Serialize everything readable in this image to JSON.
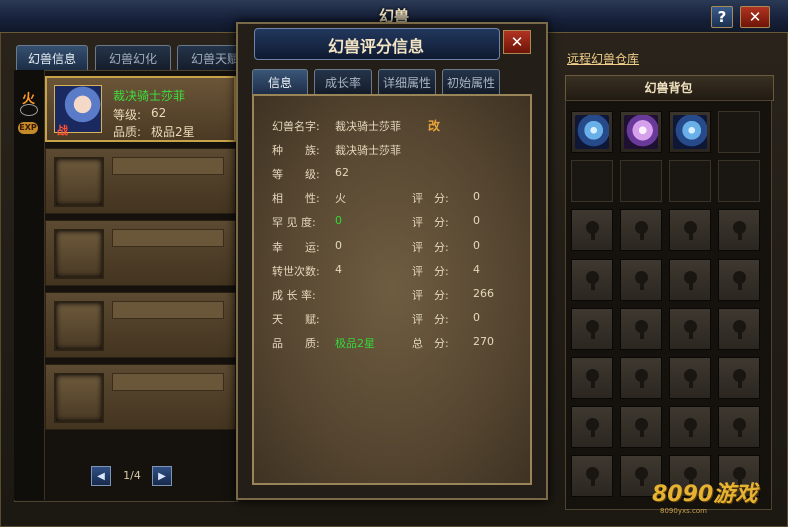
{
  "window": {
    "title": "幻兽",
    "help": "?",
    "close": "✕"
  },
  "left_tabs": [
    "幻兽信息",
    "幻兽幻化",
    "幻兽天赋"
  ],
  "side": {
    "element": "火",
    "exp": "EXP"
  },
  "active_beast": {
    "name": "裁决骑士莎菲",
    "level_label": "等级:",
    "level": "62",
    "quality_label": "品质:",
    "quality": "极品2星",
    "badge": "战"
  },
  "pager": {
    "text": "1/4"
  },
  "dialog": {
    "title": "幻兽评分信息",
    "close": "✕",
    "tabs": [
      "信息",
      "成长率",
      "详细属性",
      "初始属性"
    ],
    "edit_label": "改",
    "rows": [
      {
        "label": "幻兽名字:",
        "value": "裁决骑士莎菲",
        "score_label": "",
        "score": ""
      },
      {
        "label": "种　　族:",
        "value": "裁决骑士莎菲",
        "score_label": "",
        "score": ""
      },
      {
        "label": "等　　级:",
        "value": "62",
        "score_label": "",
        "score": ""
      },
      {
        "label": "相　　性:",
        "value": "火",
        "score_label": "评　分:",
        "score": "0"
      },
      {
        "label": "罕 见 度:",
        "value": "0",
        "score_label": "评　分:",
        "score": "0"
      },
      {
        "label": "幸　　运:",
        "value": "0",
        "score_label": "评　分:",
        "score": "0"
      },
      {
        "label": "转世次数:",
        "value": "4",
        "score_label": "评　分:",
        "score": "4"
      },
      {
        "label": "成 长 率:",
        "value": "",
        "score_label": "评　分:",
        "score": "266"
      },
      {
        "label": "天　　赋:",
        "value": "",
        "score_label": "评　分:",
        "score": "0"
      },
      {
        "label": "品　　质:",
        "value": "极品2星",
        "score_label": "总　分:",
        "score": "270"
      }
    ]
  },
  "right": {
    "remote_link": "远程幻兽仓库",
    "bag_title": "幻兽背包",
    "slots": [
      "beast-blue",
      "beast-purple",
      "beast-blue",
      "empty",
      "open",
      "open",
      "open",
      "open",
      "locked",
      "locked",
      "locked",
      "locked",
      "locked",
      "locked",
      "locked",
      "locked",
      "locked",
      "locked",
      "locked",
      "locked",
      "locked",
      "locked",
      "locked",
      "locked",
      "locked",
      "locked",
      "locked",
      "locked",
      "locked",
      "locked",
      "locked",
      "locked"
    ]
  },
  "watermark": {
    "logo": "8090游戏",
    "url": "8090yxs.com"
  }
}
